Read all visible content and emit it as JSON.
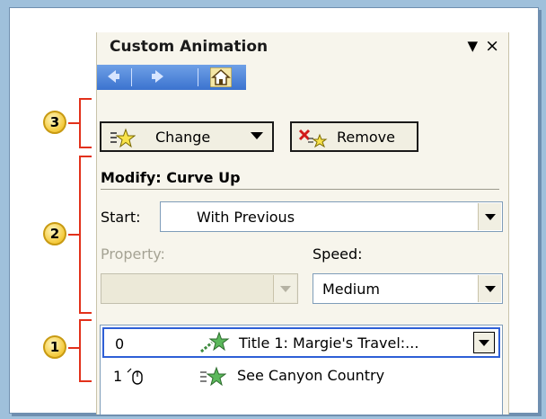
{
  "pane": {
    "title": "Custom Animation",
    "menu_glyph": "▼",
    "close_glyph": "×"
  },
  "nav": {
    "back_glyph": "◆",
    "forward_glyph": "◆"
  },
  "toolbar": {
    "change_label": "Change",
    "remove_label": "Remove"
  },
  "modify": {
    "title": "Modify: Curve Up",
    "start_label": "Start:",
    "start_value": "With Previous",
    "property_label": "Property:",
    "property_value": "",
    "speed_label": "Speed:",
    "speed_value": "Medium"
  },
  "animation_list": [
    {
      "order": "0",
      "text": "Title 1: Margie's Travel:..."
    },
    {
      "order": "1",
      "text": "See Canyon Country"
    }
  ],
  "callouts": [
    "3",
    "2",
    "1"
  ],
  "colors": {
    "callout_fill": "#f4c93b",
    "bracket": "#e2311b",
    "nav_bar": "#3b73cf",
    "selection_border": "#2e5fd6"
  }
}
